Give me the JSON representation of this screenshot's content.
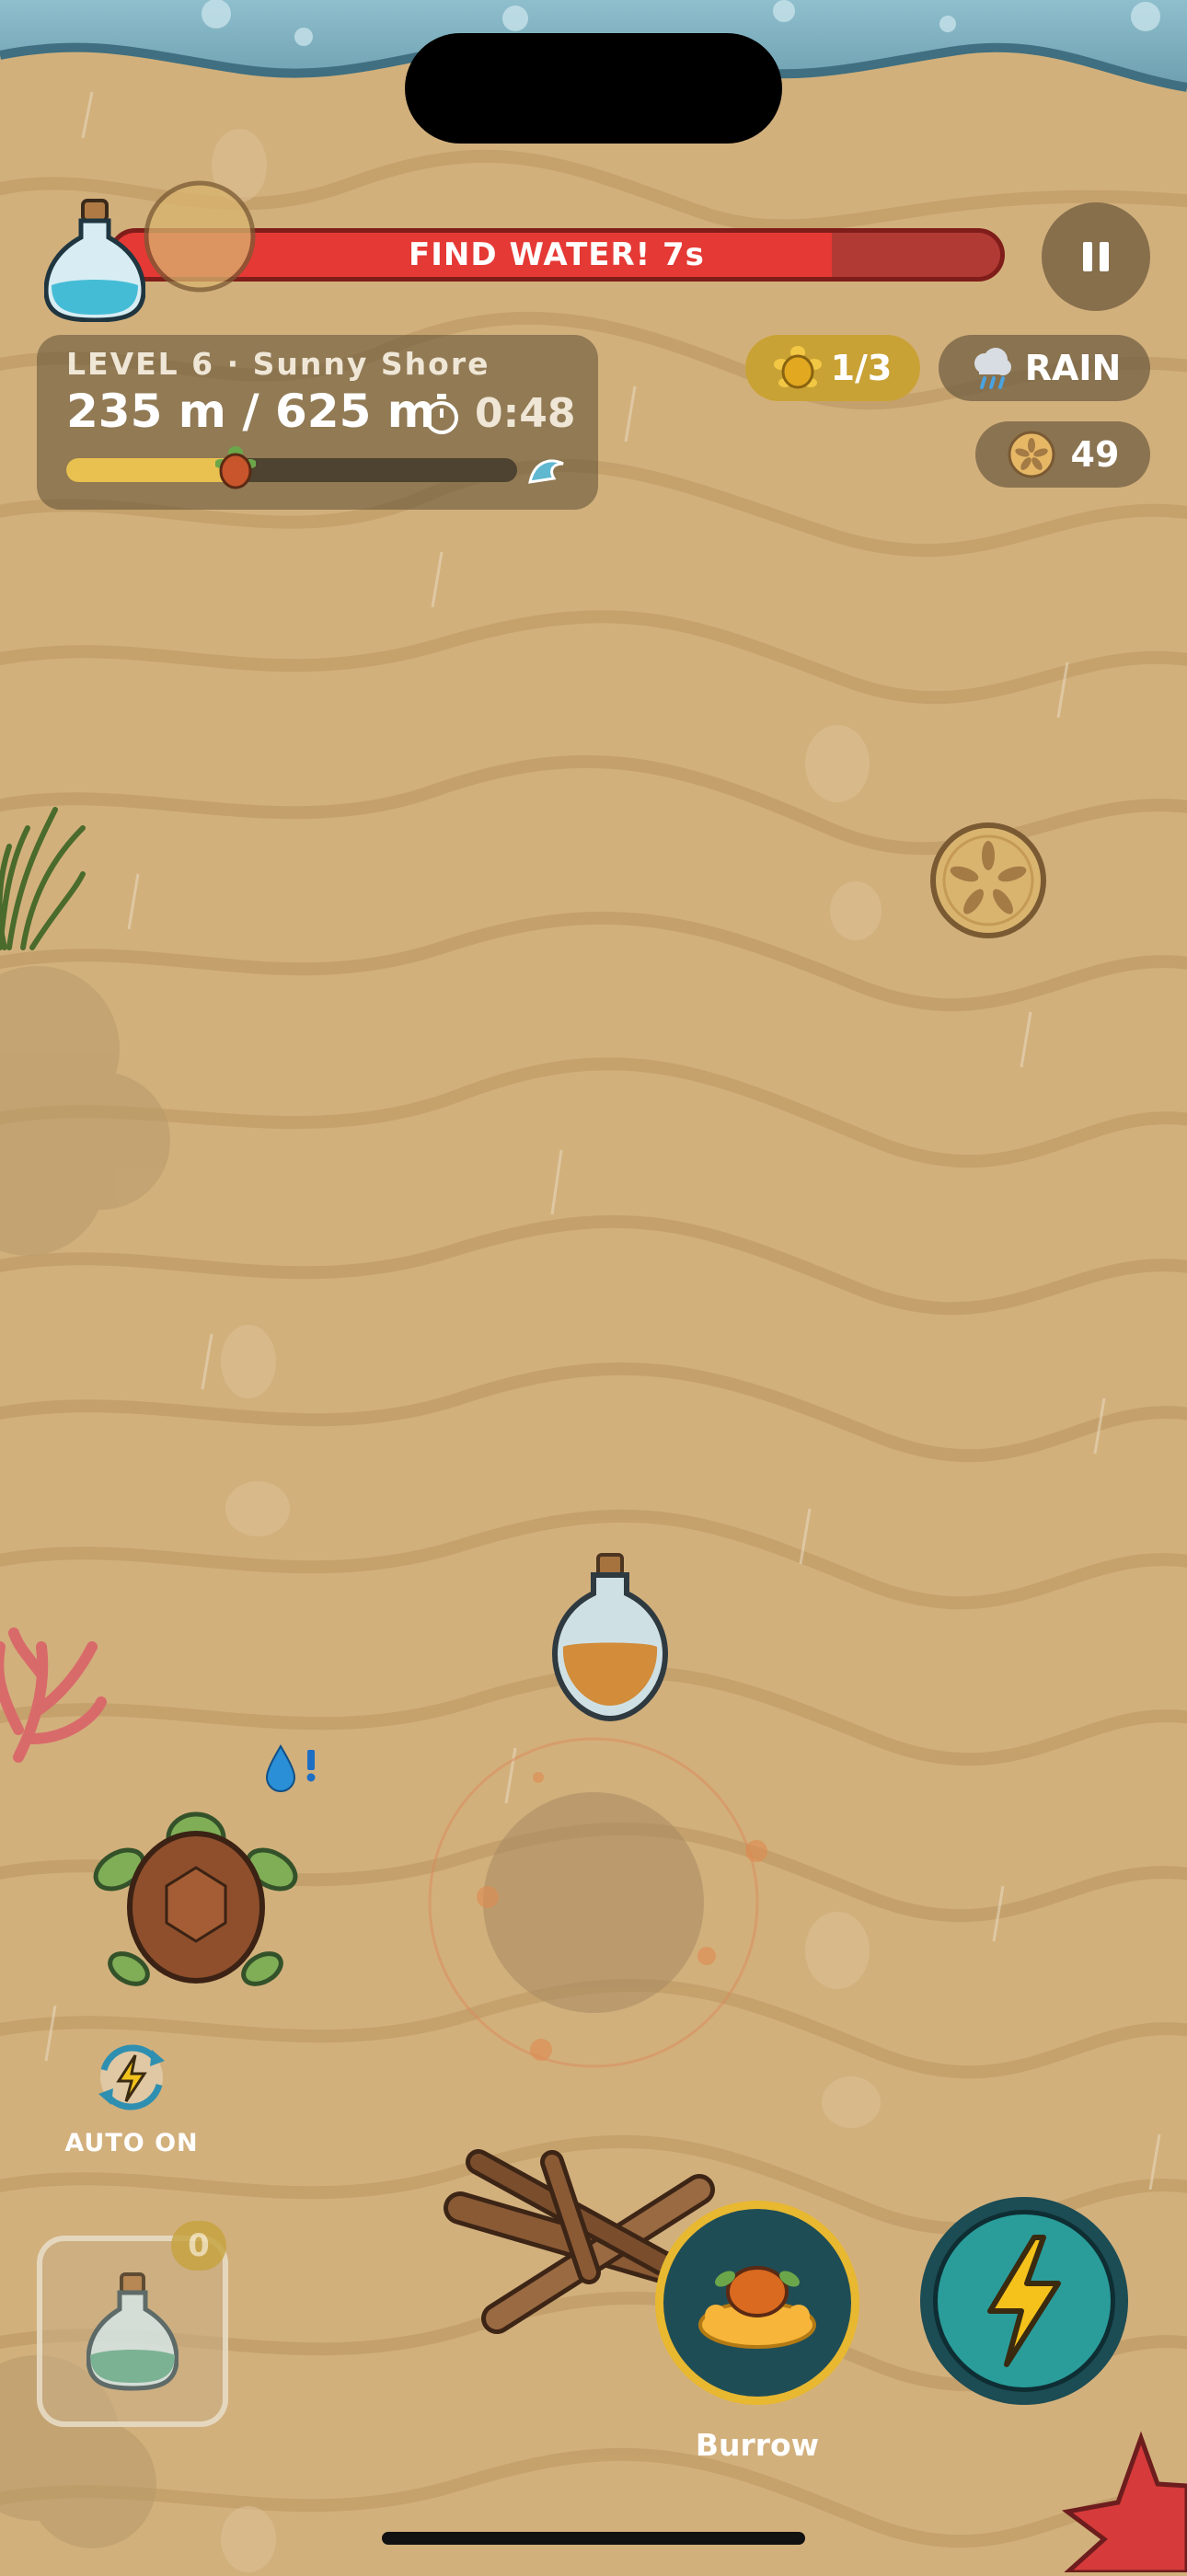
{
  "alert": {
    "text": "FIND WATER! 7s",
    "remaining_fraction": 0.81,
    "bar_color": "#e53935"
  },
  "level": {
    "title": "LEVEL 6 · Sunny Shore",
    "distance_current": "235 m",
    "distance_separator": "/",
    "distance_total": "625 m",
    "timer": "0:48",
    "progress_fraction": 0.376
  },
  "stats": {
    "turtles": "1/3",
    "weather": "RAIN",
    "sand_dollars": "49"
  },
  "controls": {
    "auto_label": "AUTO ON",
    "potion_count": "0",
    "burrow_label": "Burrow"
  },
  "colors": {
    "sand": "#d2b07c",
    "water": "#7fb0bf",
    "alert_red": "#e53935",
    "gold_pill": "#caa035",
    "dash_teal": "#2a9d9b",
    "burrow_ring": "#e8b830",
    "burrow_fill": "#1f4d55"
  },
  "icons": [
    "potion-icon",
    "sand-dollar-icon",
    "pause-icon",
    "stopwatch-icon",
    "turtle-icon",
    "wave-icon",
    "rain-cloud-icon",
    "coin-icon",
    "seaweed-icon",
    "coral-icon",
    "driftwood-icon",
    "starfish-icon",
    "water-drop-icon",
    "auto-icon",
    "lightning-icon"
  ]
}
